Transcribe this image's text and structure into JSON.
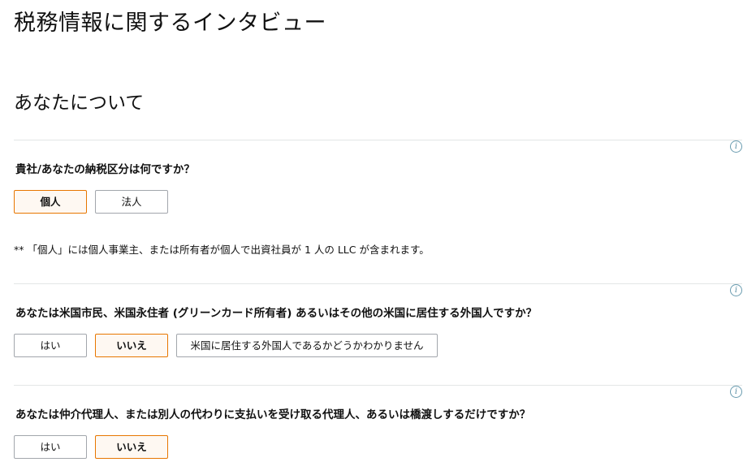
{
  "page": {
    "title": "税務情報に関するインタビュー",
    "section_title": "あなたについて"
  },
  "questions": [
    {
      "text": "貴社/あなたの納税区分は何ですか？",
      "options": [
        "個人",
        "法人"
      ],
      "selected": "個人",
      "note": "**  「個人」には個人事業主、または所有者が個人で出資社員が 1 人の LLC が含まれます。"
    },
    {
      "text": "あなたは米国市民、米国永住者 (グリーンカード所有者) あるいはその他の米国に居住する外国人ですか？",
      "options": [
        "はい",
        "いいえ",
        "米国に居住する外国人であるかどうかわかりません"
      ],
      "selected": "いいえ"
    },
    {
      "text": "あなたは仲介代理人、または別人の代わりに支払いを受け取る代理人、あるいは橋渡しするだけですか？",
      "options": [
        "はい",
        "いいえ"
      ],
      "selected": "いいえ"
    }
  ],
  "icons": {
    "info": "info-icon",
    "info_glyph": "i"
  },
  "colors": {
    "selected_border": "#e77600",
    "selected_background": "#fef8f2",
    "default_border": "#a2a6ac",
    "info_icon": "#5a8ea3"
  }
}
